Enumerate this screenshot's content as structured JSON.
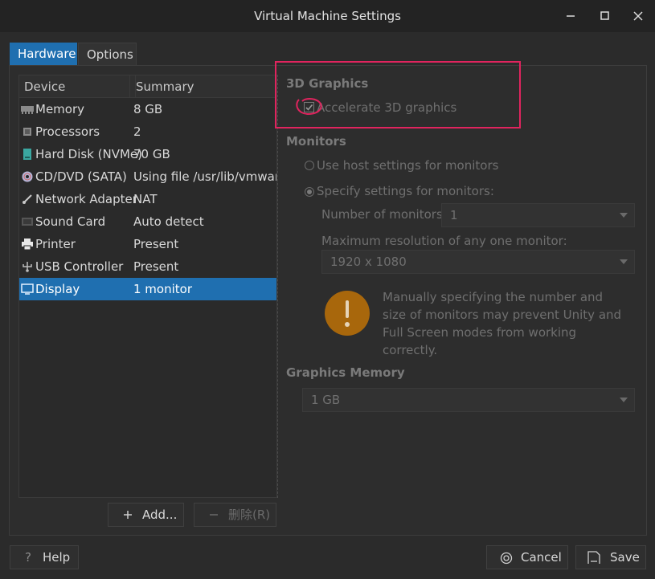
{
  "window": {
    "title": "Virtual Machine Settings"
  },
  "tabs": [
    {
      "label": "Hardware",
      "selected": true
    },
    {
      "label": "Options",
      "selected": false
    }
  ],
  "device_list": {
    "columns": [
      "Device",
      "Summary"
    ],
    "rows": [
      {
        "device": "Memory",
        "summary": "8 GB",
        "icon": "memory-icon"
      },
      {
        "device": "Processors",
        "summary": "2",
        "icon": "processor-icon"
      },
      {
        "device": "Hard Disk (NVMe)",
        "summary": "70 GB",
        "icon": "hard-disk-icon"
      },
      {
        "device": "CD/DVD (SATA)",
        "summary": "Using file /usr/lib/vmware/isoimages/linux.iso",
        "icon": "cd-dvd-icon"
      },
      {
        "device": "Network Adapter",
        "summary": "NAT",
        "icon": "network-adapter-icon"
      },
      {
        "device": "Sound Card",
        "summary": "Auto detect",
        "icon": "sound-card-icon"
      },
      {
        "device": "Printer",
        "summary": "Present",
        "icon": "printer-icon"
      },
      {
        "device": "USB Controller",
        "summary": "Present",
        "icon": "usb-icon"
      },
      {
        "device": "Display",
        "summary": "1 monitor",
        "icon": "display-icon",
        "selected": true
      }
    ]
  },
  "list_buttons": {
    "add": "Add...",
    "remove": "删除(R)"
  },
  "display_settings": {
    "graphics_3d": {
      "title": "3D Graphics",
      "accelerate_label": "Accelerate 3D graphics",
      "accelerate_checked": true
    },
    "monitors": {
      "title": "Monitors",
      "use_host_label": "Use host settings for monitors",
      "specify_label": "Specify settings for monitors:",
      "number_label": "Number of monitors:",
      "number_value": "1",
      "max_res_label": "Maximum resolution of any one monitor:",
      "max_res_value": "1920 x 1080",
      "warning": "Manually specifying the number and size of monitors may prevent Unity and Full Screen modes from working correctly."
    },
    "graphics_memory": {
      "title": "Graphics Memory",
      "value": "1 GB"
    }
  },
  "footer": {
    "help": "Help",
    "cancel": "Cancel",
    "save": "Save"
  },
  "colors": {
    "accent": "#1f6fb0",
    "annotation": "#e0245e",
    "warning": "#a8670c"
  }
}
